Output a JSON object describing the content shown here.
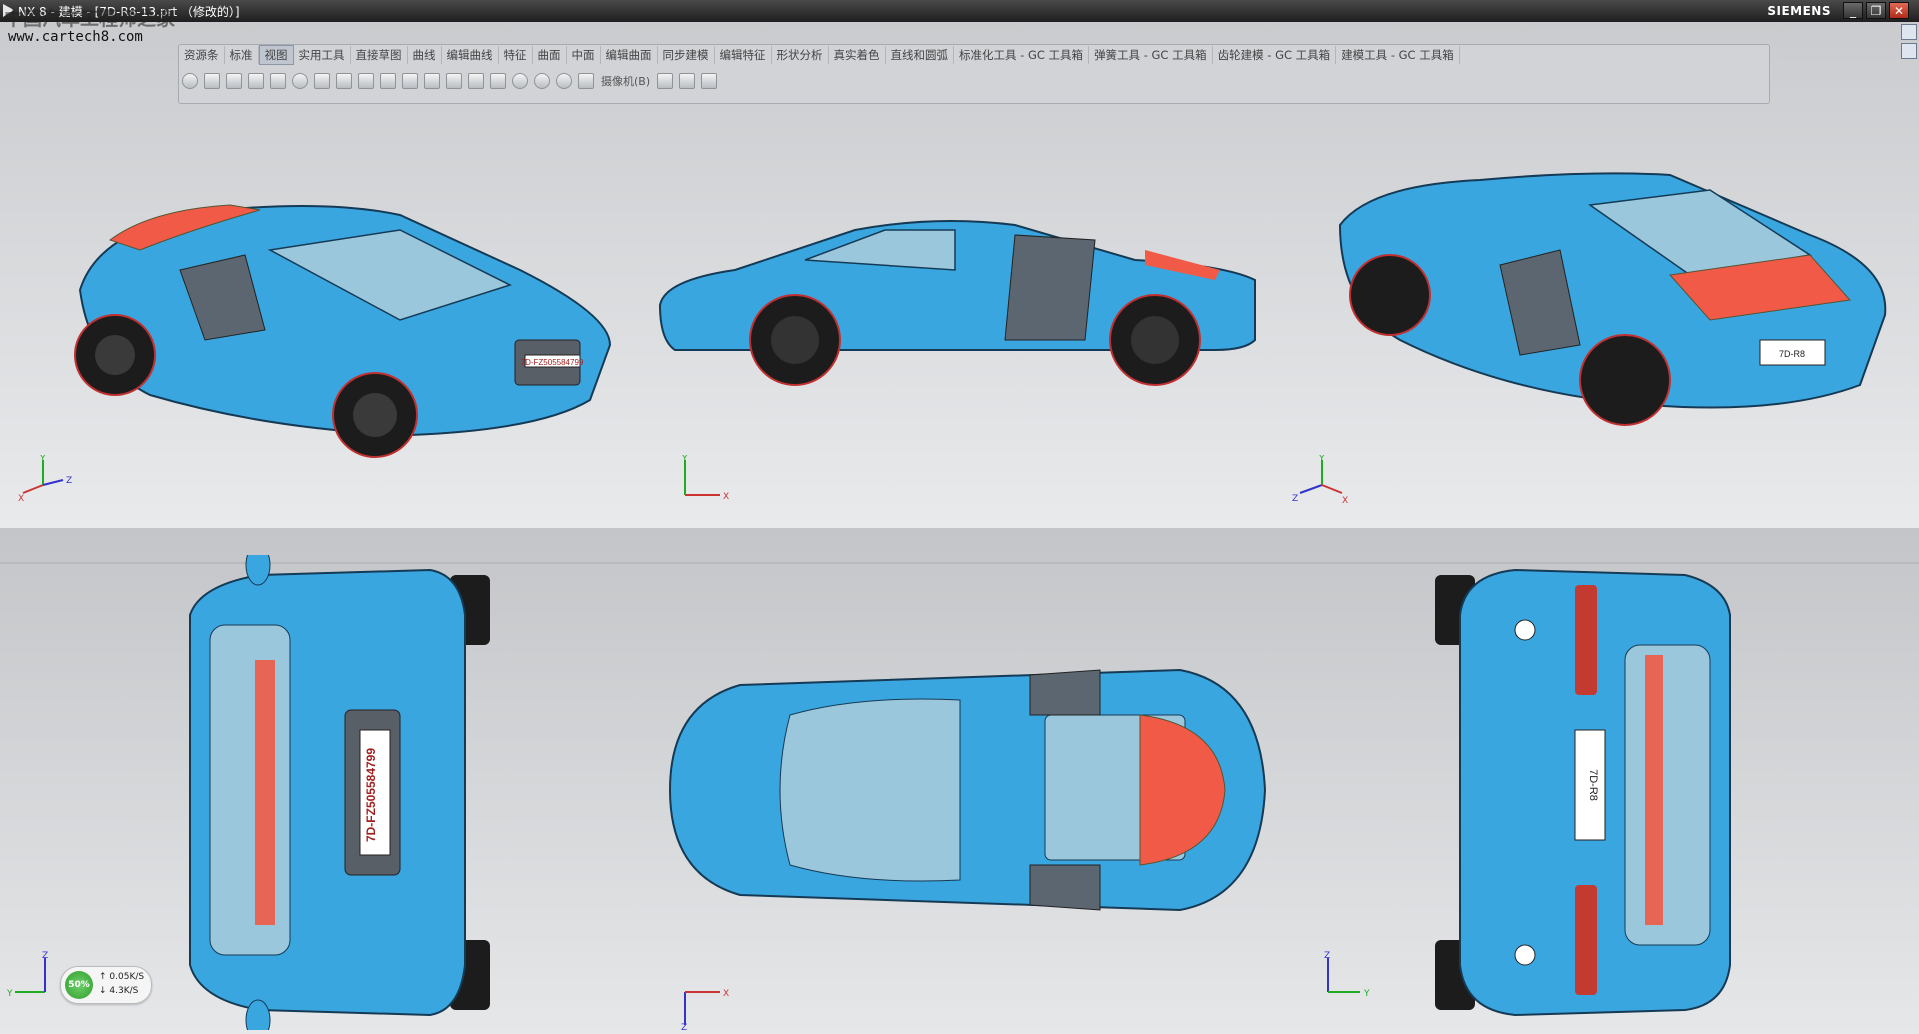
{
  "window": {
    "title": "NX 8 - 建模 - [7D-R8-13.prt （修改的）]",
    "brand": "SIEMENS",
    "minimize": "_",
    "restore": "❐",
    "close": "✕"
  },
  "watermark": {
    "site_name": "中国汽车工程师之家",
    "url": "www.cartech8.com"
  },
  "toolbar": {
    "tabs": [
      "资源条",
      "标准",
      "视图",
      "实用工具",
      "直接草图",
      "曲线",
      "编辑曲线",
      "特征",
      "曲面",
      "中面",
      "编辑曲面",
      "同步建模",
      "编辑特征",
      "形状分析",
      "真实着色",
      "直线和圆弧",
      "标准化工具 - GC 工具箱",
      "弹簧工具 - GC 工具箱",
      "齿轮建模 - GC 工具箱",
      "建模工具 - GC 工具箱"
    ],
    "active_tab": "视图",
    "camera_label": "摄像机(B)"
  },
  "views": [
    {
      "name": "isometric-front",
      "plate": "7D-FZ505584799",
      "triad": [
        "X",
        "Y",
        "Z"
      ]
    },
    {
      "name": "side",
      "triad": [
        "X",
        "Y"
      ]
    },
    {
      "name": "isometric-rear",
      "plate": "7D-R8",
      "triad": [
        "Z",
        "Y",
        "X"
      ]
    },
    {
      "name": "front",
      "plate": "7D-FZ505584799",
      "triad": [
        "Y",
        "Z"
      ]
    },
    {
      "name": "top",
      "triad": [
        "Z",
        "X"
      ]
    },
    {
      "name": "rear",
      "plate": "7D-R8",
      "triad": [
        "Z",
        "Y"
      ]
    }
  ],
  "status": {
    "percent": "50%",
    "upload": "0.05K/S",
    "download": "4.3K/S"
  },
  "colors": {
    "body": "#3aa6e0",
    "stripe": "#f05a46",
    "glass": "#9bc7dc",
    "tire": "#1c1c1c"
  }
}
